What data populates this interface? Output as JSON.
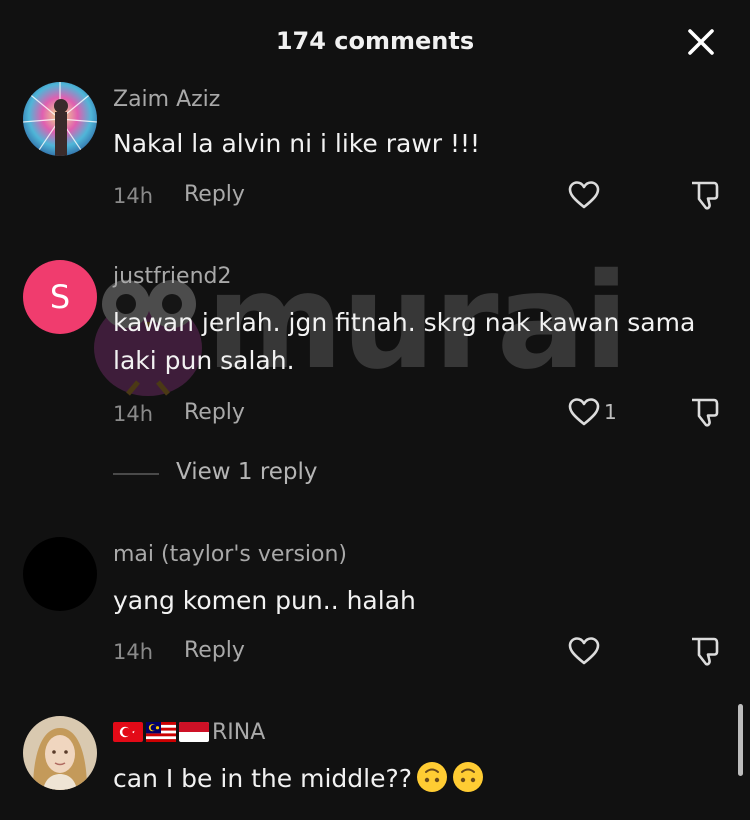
{
  "header": {
    "title": "174 comments"
  },
  "watermark": {
    "text": "murai"
  },
  "comments": [
    {
      "username": "Zaim Aziz",
      "text": "Nakal la alvin ni i like rawr !!!",
      "time": "14h",
      "reply_label": "Reply",
      "like_count": ""
    },
    {
      "username": "justfriend2",
      "avatar_letter": "S",
      "text": "kawan jerlah. jgn fitnah. skrg nak kawan sama laki pun salah.",
      "time": "14h",
      "reply_label": "Reply",
      "like_count": "1",
      "view_replies": "View 1 reply"
    },
    {
      "username": "mai (taylor's version)",
      "text": "yang komen pun.. halah",
      "time": "14h",
      "reply_label": "Reply",
      "like_count": ""
    },
    {
      "username": "RINA",
      "flags": [
        "turkey",
        "malaysia",
        "indonesia"
      ],
      "text": "can I be in the middle??",
      "emojis": [
        "upside-down-face",
        "upside-down-face"
      ]
    }
  ],
  "colors": {
    "background": "#111111",
    "avatar_s": "#f03c6e",
    "username": "#a9a9a9",
    "text": "#f2f2f2"
  }
}
